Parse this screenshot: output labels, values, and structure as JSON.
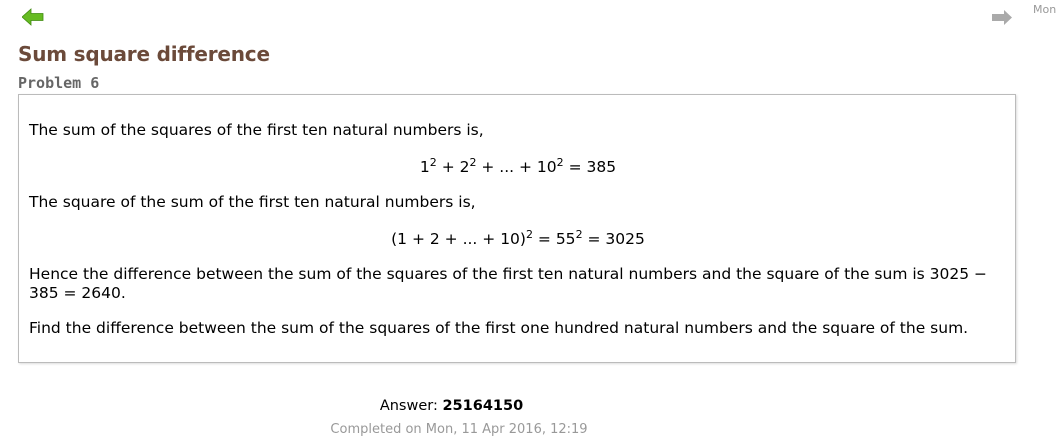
{
  "nav": {
    "prev_icon": "left-arrow-icon",
    "next_icon": "right-arrow-icon",
    "corner_text": "Mon",
    "prev_color": "#66bb22",
    "next_color": "#aaaaaa"
  },
  "problem": {
    "title": "Sum square difference",
    "number_label": "Problem 6",
    "paragraph1": "The sum of the squares of the first ten natural numbers is,",
    "equation1": {
      "t1": "1",
      "s1": "2",
      "t2": " + 2",
      "s2": "2",
      "t3": " + ... + 10",
      "s3": "2",
      "t4": " = 385"
    },
    "paragraph2": "The square of the sum of the first ten natural numbers is,",
    "equation2": {
      "t1": "(1 + 2 + ... + 10)",
      "s1": "2",
      "t2": " = 55",
      "s2": "2",
      "t3": " = 3025"
    },
    "paragraph3": "Hence the difference between the sum of the squares of the first ten natural numbers and the square of the sum is 3025 − 385 = 2640.",
    "paragraph4": "Find the difference between the sum of the squares of the first one hundred natural numbers and the square of the sum."
  },
  "answer": {
    "label": "Answer: ",
    "value": "25164150",
    "completed": "Completed on Mon, 11 Apr 2016, 12:19"
  },
  "colors": {
    "title": "#6b4a3a",
    "subtitle": "#666666",
    "muted": "#999999",
    "box_border": "#bbbbbb"
  }
}
